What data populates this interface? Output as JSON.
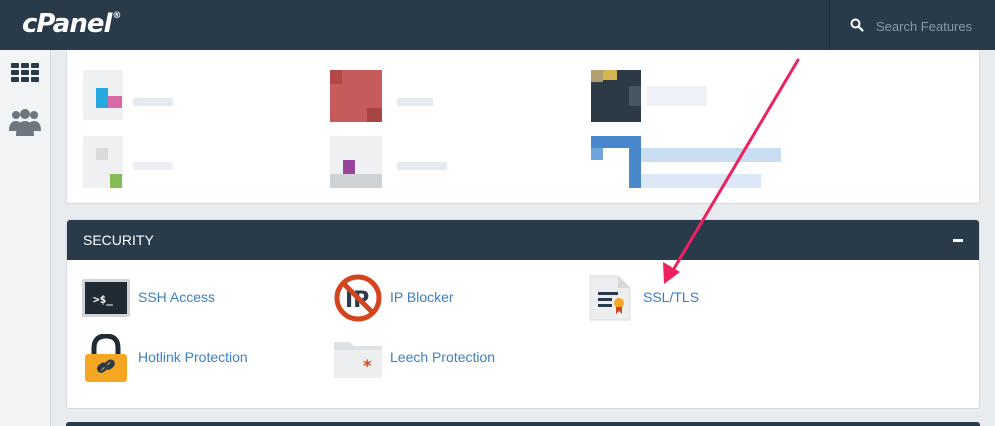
{
  "header": {
    "logo": "cPanel",
    "logo_mark": "®",
    "search_placeholder": "Search Features"
  },
  "security": {
    "title": "SECURITY",
    "items": [
      {
        "label": "SSH Access"
      },
      {
        "label": "IP Blocker"
      },
      {
        "label": "SSL/TLS"
      },
      {
        "label": "Hotlink Protection"
      },
      {
        "label": "Leech Protection"
      }
    ]
  },
  "colors": {
    "header_bg": "#293a4a",
    "link": "#3b7fc4",
    "annotation_arrow": "#ee2060"
  }
}
